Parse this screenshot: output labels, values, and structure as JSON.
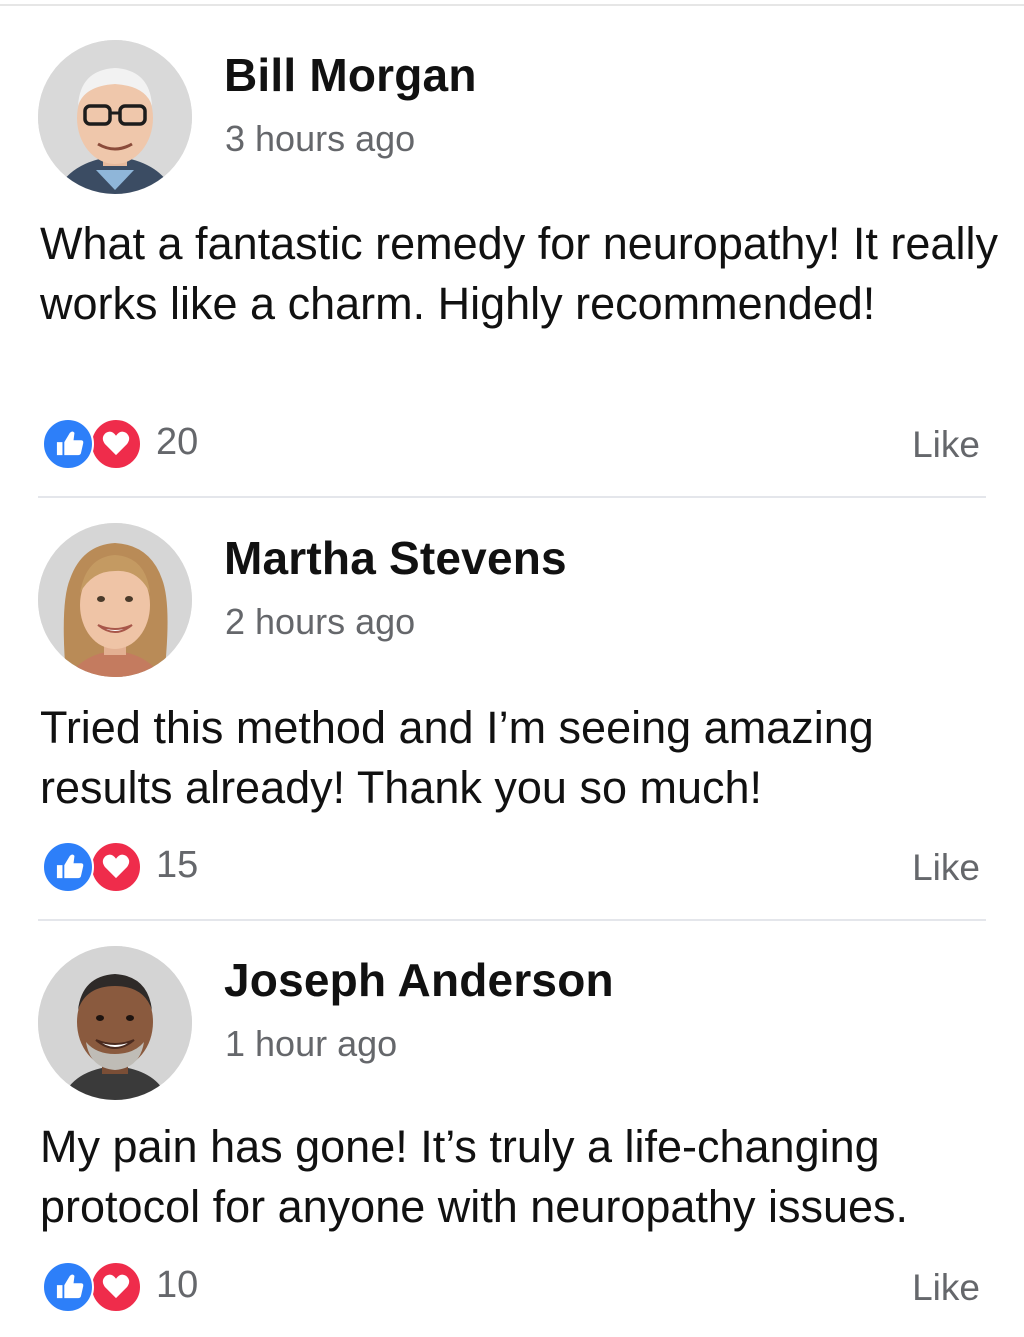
{
  "comments": [
    {
      "name": "Bill Morgan",
      "time": "3 hours ago",
      "text": "What a fantastic remedy for neuropathy! It really works like a charm. Highly recommended!",
      "reaction_count": "20",
      "like_label": "Like"
    },
    {
      "name": "Martha Stevens",
      "time": "2 hours ago",
      "text": "Tried this method and I’m seeing amazing results already! Thank you so much!",
      "reaction_count": "15",
      "like_label": "Like"
    },
    {
      "name": "Joseph Anderson",
      "time": "1 hour ago",
      "text": "My pain has gone! It’s truly a life-changing protocol for anyone with neuropathy issues.",
      "reaction_count": "10",
      "like_label": "Like"
    }
  ],
  "colors": {
    "like_blue": "#2d7ff9",
    "love_red": "#ef2c4b",
    "secondary_text": "#65676b",
    "divider": "#e4e6eb"
  },
  "icons": {
    "reaction_1": "thumbs-up-icon",
    "reaction_2": "heart-icon"
  }
}
